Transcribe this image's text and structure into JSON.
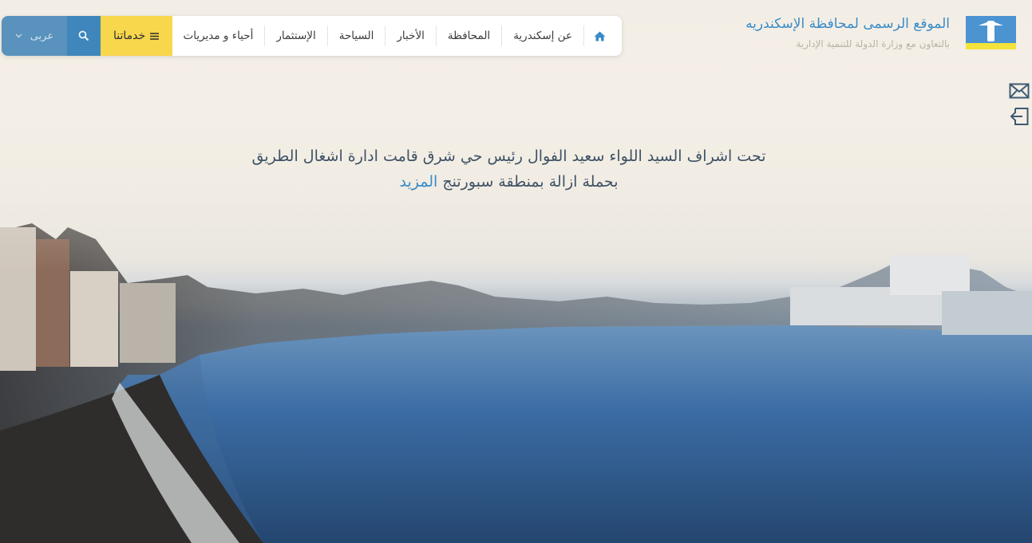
{
  "brand": {
    "title": "الموقع الرسمى لمحافظة الإسكندريه",
    "subtitle": "بالتعاون مع وزارة الدولة للتنمية الإدارية"
  },
  "nav": {
    "home_icon": "home-icon",
    "items": [
      {
        "label": "عن إسكندرية"
      },
      {
        "label": "المحافظة"
      },
      {
        "label": "الأخبار"
      },
      {
        "label": "السياحة"
      },
      {
        "label": "الإستثمار"
      },
      {
        "label": "أحياء و مديريات"
      }
    ],
    "services_label": "خدماتنا",
    "services_icon": "menu-icon",
    "search_icon": "search-icon",
    "language_label": "عربى",
    "language_icon": "chevron-down-icon"
  },
  "side": {
    "mail_icon": "mail-icon",
    "login_icon": "login-icon"
  },
  "news": {
    "line1": "تحت اشراف السيد اللواء سعيد الفوال رئيس حي شرق قامت ادارة اشغال الطريق",
    "line2": "بحملة ازالة بمنطقة سبورتنج",
    "more": "المزيد"
  },
  "colors": {
    "accent": "#3a8bc6",
    "services_bg": "#f9d74d",
    "language_bg": "#5993bd",
    "search_bg": "#3e86bb"
  }
}
